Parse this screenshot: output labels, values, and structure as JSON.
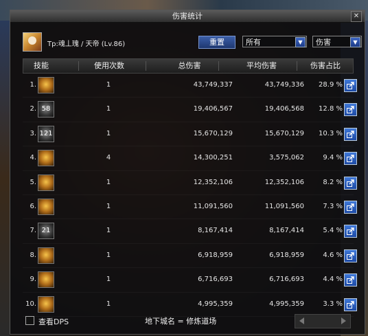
{
  "window": {
    "title": "伤害统计",
    "close": "✕"
  },
  "character": {
    "name": "Tp:魂丄瑰 / 天帝 (Lv.86)"
  },
  "controls": {
    "reset_label": "重置",
    "filter_selected": "所有",
    "type_selected": "伤害"
  },
  "columns": [
    "技能",
    "使用次数",
    "总伤害",
    "平均伤害",
    "伤害占比"
  ],
  "rows": [
    {
      "rank": "1.",
      "icon_text": "",
      "count": "1",
      "total": "43,749,337",
      "avg": "43,749,336",
      "pct": "28.9 %"
    },
    {
      "rank": "2.",
      "icon_text": "58",
      "count": "1",
      "total": "19,406,567",
      "avg": "19,406,568",
      "pct": "12.8 %"
    },
    {
      "rank": "3.",
      "icon_text": "121",
      "count": "1",
      "total": "15,670,129",
      "avg": "15,670,129",
      "pct": "10.3 %"
    },
    {
      "rank": "4.",
      "icon_text": "",
      "count": "4",
      "total": "14,300,251",
      "avg": "3,575,062",
      "pct": "9.4 %"
    },
    {
      "rank": "5.",
      "icon_text": "",
      "count": "1",
      "total": "12,352,106",
      "avg": "12,352,106",
      "pct": "8.2 %"
    },
    {
      "rank": "6.",
      "icon_text": "",
      "count": "1",
      "total": "11,091,560",
      "avg": "11,091,560",
      "pct": "7.3 %"
    },
    {
      "rank": "7.",
      "icon_text": "21",
      "count": "1",
      "total": "8,167,414",
      "avg": "8,167,414",
      "pct": "5.4 %"
    },
    {
      "rank": "8.",
      "icon_text": "",
      "count": "1",
      "total": "6,918,959",
      "avg": "6,918,959",
      "pct": "4.6 %"
    },
    {
      "rank": "9.",
      "icon_text": "",
      "count": "1",
      "total": "6,716,693",
      "avg": "6,716,693",
      "pct": "4.4 %"
    },
    {
      "rank": "10.",
      "icon_text": "",
      "count": "1",
      "total": "4,995,359",
      "avg": "4,995,359",
      "pct": "3.3 %"
    }
  ],
  "footer": {
    "view_dps_label": "查看DPS",
    "dungeon": "地下城名 = 修炼道场"
  },
  "icons": {
    "share": "share-icon",
    "close": "close-icon",
    "dropdown": "chevron-down-icon"
  }
}
